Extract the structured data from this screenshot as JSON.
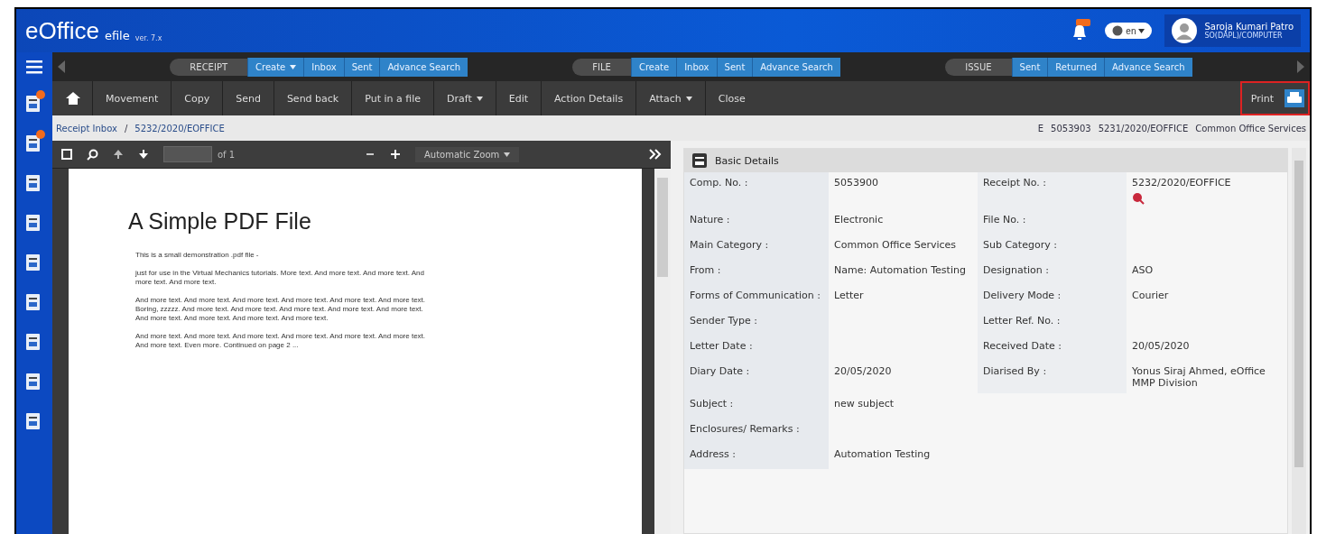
{
  "header": {
    "logo": "eOffice",
    "product": "efile",
    "version": "ver. 7.x",
    "language": "en",
    "user": {
      "name": "Saroja Kumari Patro",
      "role": "SO(DAPL)/COMPUTER"
    }
  },
  "modules": [
    {
      "label": "RECEIPT",
      "links": [
        {
          "label": "Create",
          "caret": true
        },
        {
          "label": "Inbox",
          "caret": false
        },
        {
          "label": "Sent",
          "caret": false
        },
        {
          "label": "Advance Search",
          "caret": false
        }
      ]
    },
    {
      "label": "FILE",
      "links": [
        {
          "label": "Create",
          "caret": false
        },
        {
          "label": "Inbox",
          "caret": false
        },
        {
          "label": "Sent",
          "caret": false
        },
        {
          "label": "Advance Search",
          "caret": false
        }
      ]
    },
    {
      "label": "ISSUE",
      "links": [
        {
          "label": "Sent",
          "caret": false
        },
        {
          "label": "Returned",
          "caret": false
        },
        {
          "label": "Advance Search",
          "caret": false
        }
      ]
    }
  ],
  "toolbar": [
    {
      "label": "Movement",
      "caret": false
    },
    {
      "label": "Copy",
      "caret": false
    },
    {
      "label": "Send",
      "caret": false
    },
    {
      "label": "Send back",
      "caret": false
    },
    {
      "label": "Put in a file",
      "caret": false
    },
    {
      "label": "Draft",
      "caret": true
    },
    {
      "label": "Edit",
      "caret": false
    },
    {
      "label": "Action Details",
      "caret": false
    },
    {
      "label": "Attach",
      "caret": true
    },
    {
      "label": "Close",
      "caret": false
    }
  ],
  "print": "Print",
  "breadcrumb": [
    "Receipt Inbox",
    "/",
    "5232/2020/EOFFICE"
  ],
  "summary": [
    "E",
    "5053903",
    "5231/2020/EOFFICE",
    "Common Office Services"
  ],
  "viewer": {
    "page_of": "of 1",
    "zoom": "Automatic Zoom",
    "title": "A Simple PDF File",
    "paragraphs": [
      "This is a small demonstration .pdf file -",
      "just for use in the Virtual Mechanics tutorials. More text. And more text. And more text. And more text. And more text.",
      "And more text. And more text. And more text. And more text. And more text. And more text. Boring, zzzzz. And more text. And more text. And more text. And more text. And more text. And more text. And more text. And more text. And more text.",
      "And more text. And more text. And more text. And more text. And more text. And more text. And more text. Even more. Continued on page 2 ..."
    ]
  },
  "details": {
    "title": "Basic Details",
    "rows": [
      {
        "cells": [
          {
            "label": "Comp. No. :",
            "value": "5053900"
          },
          {
            "label": "Receipt No. :",
            "value": "5232/2020/EOFFICE"
          }
        ]
      },
      {
        "cells": [
          {
            "label": "Nature :",
            "value": "Electronic"
          },
          {
            "label": "File No. :"
          }
        ]
      },
      {
        "cells": [
          {
            "label": "Main Category :",
            "value": "Common Office Services"
          },
          {
            "label": "Sub Category :"
          }
        ]
      },
      {
        "cells": [
          {
            "label": "From :",
            "value": "Name: Automation Testing"
          },
          {
            "label": "Designation :",
            "value": "ASO"
          }
        ]
      },
      {
        "cells": [
          {
            "label": "Forms of Communication :",
            "value": "Letter"
          },
          {
            "label": "Delivery Mode :",
            "value": "Courier"
          }
        ]
      },
      {
        "cells": [
          {
            "label": "Sender Type :"
          },
          {
            "label": "Letter Ref. No. :"
          }
        ]
      },
      {
        "cells": [
          {
            "label": "Letter Date :"
          },
          {
            "label": "Received Date :",
            "value": "20/05/2020"
          }
        ]
      },
      {
        "cells": [
          {
            "label": "Diary Date :",
            "value": "20/05/2020"
          },
          {
            "label": "Diarised By :",
            "value": "Yonus Siraj Ahmed, eOffice MMP Division"
          }
        ]
      },
      {
        "cells": [
          {
            "label": "Subject :",
            "value": "new subject"
          }
        ]
      },
      {
        "cells": [
          {
            "label": "Enclosures/ Remarks :"
          }
        ]
      },
      {
        "cells": [
          {
            "label": "Address :",
            "value": "Automation Testing"
          }
        ]
      }
    ]
  }
}
